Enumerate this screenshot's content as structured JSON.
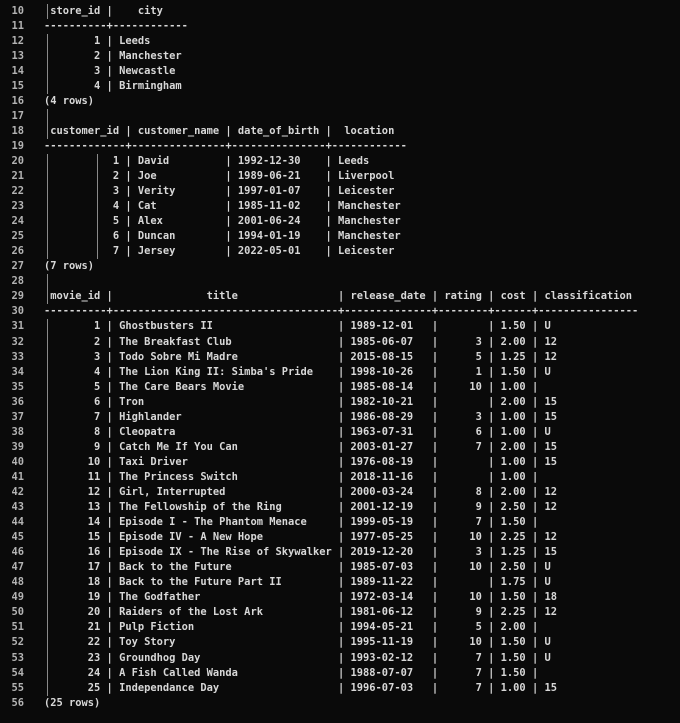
{
  "editor": {
    "background": "#0a0a0a",
    "text_color": "#d8d8d8",
    "line_number_color": "#b3b3b3",
    "indent_guide_color": "#8a8a8a",
    "first_line_number": 10,
    "last_line_number": 56
  },
  "results": [
    {
      "type": "table",
      "columns": [
        {
          "name": "store_id",
          "width": 10,
          "align": "right"
        },
        {
          "name": "city",
          "width": 12,
          "align": "left"
        }
      ],
      "rows": [
        [
          "1",
          "Leeds"
        ],
        [
          "2",
          "Manchester"
        ],
        [
          "3",
          "Newcastle"
        ],
        [
          "4",
          "Birmingham"
        ]
      ],
      "footer": "(4 rows)"
    },
    {
      "type": "blank"
    },
    {
      "type": "table",
      "columns": [
        {
          "name": "customer_id",
          "width": 13,
          "align": "right"
        },
        {
          "name": "customer_name",
          "width": 15,
          "align": "left"
        },
        {
          "name": "date_of_birth",
          "width": 15,
          "align": "left"
        },
        {
          "name": "location",
          "width": 12,
          "align": "left"
        }
      ],
      "rows": [
        [
          "1",
          "David",
          "1992-12-30",
          "Leeds"
        ],
        [
          "2",
          "Joe",
          "1989-06-21",
          "Liverpool"
        ],
        [
          "3",
          "Verity",
          "1997-01-07",
          "Leicester"
        ],
        [
          "4",
          "Cat",
          "1985-11-02",
          "Manchester"
        ],
        [
          "5",
          "Alex",
          "2001-06-24",
          "Manchester"
        ],
        [
          "6",
          "Duncan",
          "1994-01-19",
          "Manchester"
        ],
        [
          "7",
          "Jersey",
          "2022-05-01",
          "Leicester"
        ]
      ],
      "footer": "(7 rows)"
    },
    {
      "type": "blank"
    },
    {
      "type": "table",
      "columns": [
        {
          "name": "movie_id",
          "width": 10,
          "align": "right"
        },
        {
          "name": "title",
          "width": 36,
          "align": "left"
        },
        {
          "name": "release_date",
          "width": 14,
          "align": "left"
        },
        {
          "name": "rating",
          "width": 8,
          "align": "right"
        },
        {
          "name": "cost",
          "width": 6,
          "align": "right"
        },
        {
          "name": "classification",
          "width": 16,
          "align": "left"
        }
      ],
      "rows": [
        [
          "1",
          "Ghostbusters II",
          "1989-12-01",
          "",
          "1.50",
          "U"
        ],
        [
          "2",
          "The Breakfast Club",
          "1985-06-07",
          "3",
          "2.00",
          "12"
        ],
        [
          "3",
          "Todo Sobre Mi Madre",
          "2015-08-15",
          "5",
          "1.25",
          "12"
        ],
        [
          "4",
          "The Lion King II: Simba's Pride",
          "1998-10-26",
          "1",
          "1.50",
          "U"
        ],
        [
          "5",
          "The Care Bears Movie",
          "1985-08-14",
          "10",
          "1.00",
          ""
        ],
        [
          "6",
          "Tron",
          "1982-10-21",
          "",
          "2.00",
          "15"
        ],
        [
          "7",
          "Highlander",
          "1986-08-29",
          "3",
          "1.00",
          "15"
        ],
        [
          "8",
          "Cleopatra",
          "1963-07-31",
          "6",
          "1.00",
          "U"
        ],
        [
          "9",
          "Catch Me If You Can",
          "2003-01-27",
          "7",
          "2.00",
          "15"
        ],
        [
          "10",
          "Taxi Driver",
          "1976-08-19",
          "",
          "1.00",
          "15"
        ],
        [
          "11",
          "The Princess Switch",
          "2018-11-16",
          "",
          "1.00",
          ""
        ],
        [
          "12",
          "Girl, Interrupted",
          "2000-03-24",
          "8",
          "2.00",
          "12"
        ],
        [
          "13",
          "The Fellowship of the Ring",
          "2001-12-19",
          "9",
          "2.50",
          "12"
        ],
        [
          "14",
          "Episode I - The Phantom Menace",
          "1999-05-19",
          "7",
          "1.50",
          ""
        ],
        [
          "15",
          "Episode IV - A New Hope",
          "1977-05-25",
          "10",
          "2.25",
          "12"
        ],
        [
          "16",
          "Episode IX - The Rise of Skywalker",
          "2019-12-20",
          "3",
          "1.25",
          "15"
        ],
        [
          "17",
          "Back to the Future",
          "1985-07-03",
          "10",
          "2.50",
          "U"
        ],
        [
          "18",
          "Back to the Future Part II",
          "1989-11-22",
          "",
          "1.75",
          "U"
        ],
        [
          "19",
          "The Godfather",
          "1972-03-14",
          "10",
          "1.50",
          "18"
        ],
        [
          "20",
          "Raiders of the Lost Ark",
          "1981-06-12",
          "9",
          "2.25",
          "12"
        ],
        [
          "21",
          "Pulp Fiction",
          "1994-05-21",
          "5",
          "2.00",
          ""
        ],
        [
          "22",
          "Toy Story",
          "1995-11-19",
          "10",
          "1.50",
          "U"
        ],
        [
          "23",
          "Groundhog Day",
          "1993-02-12",
          "7",
          "1.50",
          "U"
        ],
        [
          "24",
          "A Fish Called Wanda",
          "1988-07-07",
          "7",
          "1.50",
          ""
        ],
        [
          "25",
          "Independance Day",
          "1996-07-03",
          "7",
          "1.00",
          "15"
        ]
      ],
      "footer": "(25 rows)"
    }
  ]
}
